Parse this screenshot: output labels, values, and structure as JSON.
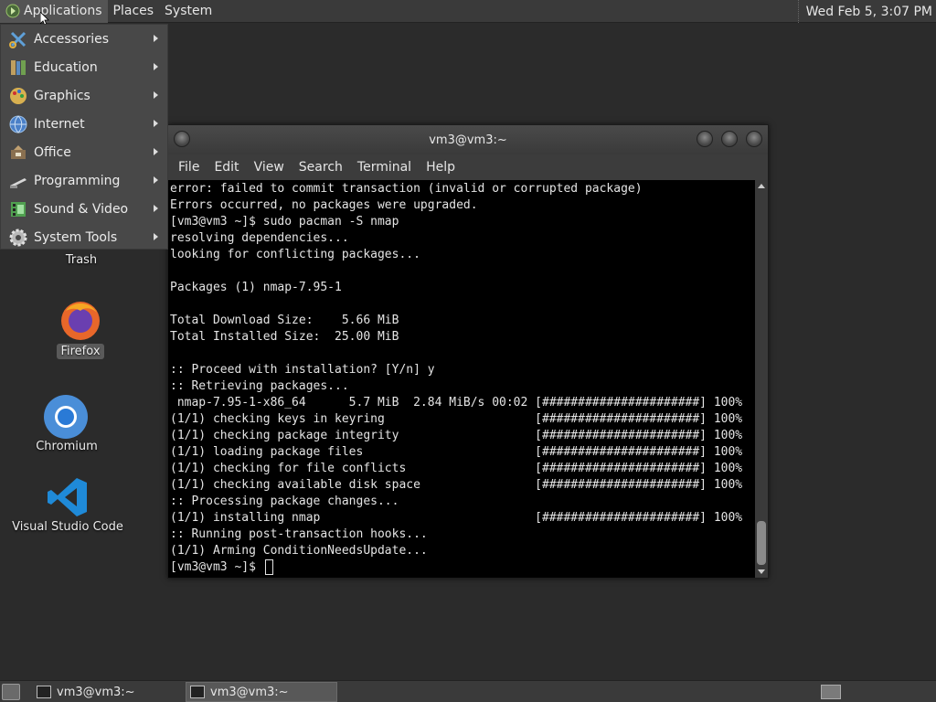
{
  "top_panel": {
    "menus": [
      "Applications",
      "Places",
      "System"
    ],
    "clock": "Wed Feb  5,  3:07 PM"
  },
  "app_menu": {
    "items": [
      {
        "label": "Accessories",
        "icon": "accessories-icon"
      },
      {
        "label": "Education",
        "icon": "education-icon"
      },
      {
        "label": "Graphics",
        "icon": "graphics-icon"
      },
      {
        "label": "Internet",
        "icon": "internet-icon"
      },
      {
        "label": "Office",
        "icon": "office-icon"
      },
      {
        "label": "Programming",
        "icon": "programming-icon"
      },
      {
        "label": "Sound & Video",
        "icon": "sound-video-icon"
      },
      {
        "label": "System Tools",
        "icon": "system-tools-icon"
      }
    ]
  },
  "desktop": {
    "icons": [
      {
        "label": "Trash",
        "icon": "trash-icon"
      },
      {
        "label": "Firefox",
        "icon": "firefox-icon"
      },
      {
        "label": "Chromium",
        "icon": "chromium-icon"
      },
      {
        "label": "Visual Studio Code",
        "icon": "vscode-icon"
      }
    ]
  },
  "terminal": {
    "title": "vm3@vm3:~",
    "menu": [
      "File",
      "Edit",
      "View",
      "Search",
      "Terminal",
      "Help"
    ],
    "lines": [
      "error: failed to commit transaction (invalid or corrupted package)",
      "Errors occurred, no packages were upgraded.",
      "[vm3@vm3 ~]$ sudo pacman -S nmap",
      "resolving dependencies...",
      "looking for conflicting packages...",
      "",
      "Packages (1) nmap-7.95-1",
      "",
      "Total Download Size:    5.66 MiB",
      "Total Installed Size:  25.00 MiB",
      "",
      ":: Proceed with installation? [Y/n] y",
      ":: Retrieving packages...",
      " nmap-7.95-1-x86_64      5.7 MiB  2.84 MiB/s 00:02 [######################] 100%",
      "(1/1) checking keys in keyring                     [######################] 100%",
      "(1/1) checking package integrity                   [######################] 100%",
      "(1/1) loading package files                        [######################] 100%",
      "(1/1) checking for file conflicts                  [######################] 100%",
      "(1/1) checking available disk space                [######################] 100%",
      ":: Processing package changes...",
      "(1/1) installing nmap                              [######################] 100%",
      ":: Running post-transaction hooks...",
      "(1/1) Arming ConditionNeedsUpdate..."
    ],
    "prompt": "[vm3@vm3 ~]$ "
  },
  "taskbar": {
    "tasks": [
      "vm3@vm3:~",
      "vm3@vm3:~"
    ]
  }
}
